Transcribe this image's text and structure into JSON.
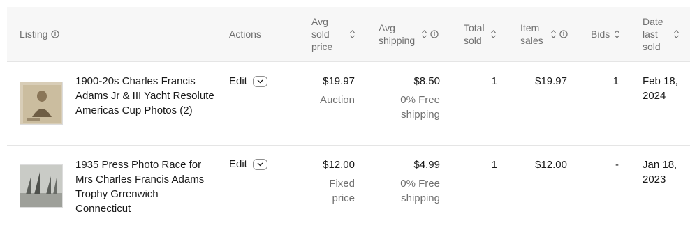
{
  "columns": {
    "listing": "Listing",
    "actions": "Actions",
    "avg_sold_price": [
      "Avg",
      "sold",
      "price"
    ],
    "avg_shipping": [
      "Avg",
      "shipping"
    ],
    "total_sold": [
      "Total",
      "sold"
    ],
    "item_sales": [
      "Item",
      "sales"
    ],
    "bids": "Bids",
    "date_last_sold": [
      "Date",
      "last",
      "sold"
    ]
  },
  "rows": [
    {
      "title": "1900-20s Charles Francis Adams Jr & III Yacht Resolute Americas Cup Photos (2)",
      "action": "Edit",
      "avg_sold_price": "$19.97",
      "format": "Auction",
      "avg_shipping": "$8.50",
      "shipping_note": "0% Free shipping",
      "total_sold": "1",
      "item_sales": "$19.97",
      "bids": "1",
      "date_last_sold": "Feb 18, 2024"
    },
    {
      "title": "1935 Press Photo Race for Mrs Charles Francis Adams Trophy Grrenwich Connecticut",
      "action": "Edit",
      "avg_sold_price": "$12.00",
      "format": "Fixed price",
      "avg_shipping": "$4.99",
      "shipping_note": "0% Free shipping",
      "total_sold": "1",
      "item_sales": "$12.00",
      "bids": "-",
      "date_last_sold": "Jan 18, 2023"
    }
  ]
}
